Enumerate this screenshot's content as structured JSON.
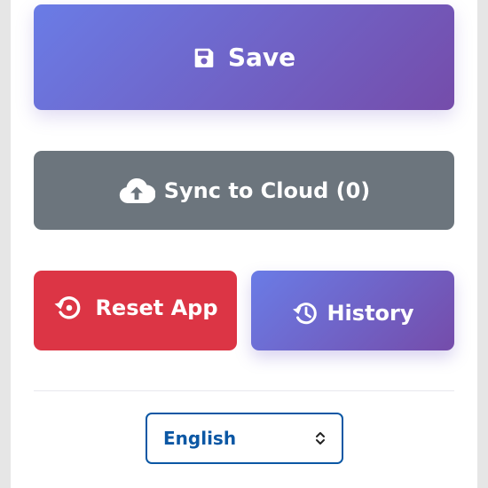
{
  "actions": {
    "save": {
      "label": "Save",
      "icon": "floppy-disk-icon"
    },
    "sync": {
      "label": "Sync to Cloud (0)",
      "icon": "cloud-upload-icon"
    },
    "reset": {
      "label": "Reset App",
      "icon": "reset-icon",
      "color": "#dc3545"
    },
    "history": {
      "label": "History",
      "icon": "history-icon"
    }
  },
  "language": {
    "selected": "English",
    "icon": "chevron-up-down-icon"
  },
  "colors": {
    "gradient_start": "#6a7ce6",
    "gradient_end": "#754caa",
    "sync_gray": "#6c757d",
    "reset_red": "#dc3545",
    "select_blue": "#0b57a4"
  }
}
